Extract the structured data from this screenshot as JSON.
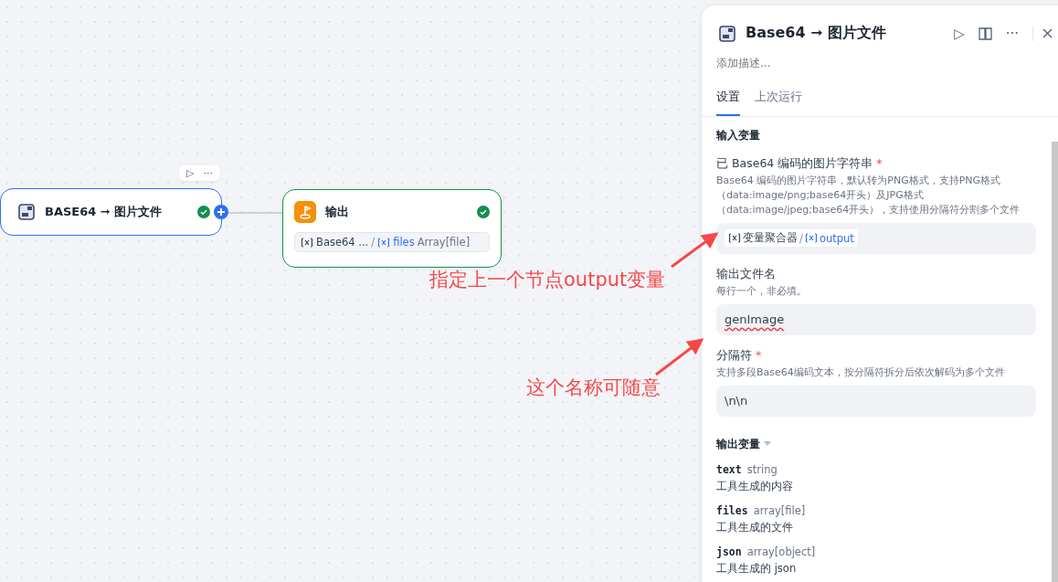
{
  "canvas": {
    "nodes": [
      {
        "kind": "tool",
        "title": "BASE64 ➞ 图片文件",
        "status_ok": true,
        "selected": true,
        "toolbar": {
          "run": "▷",
          "more": "···"
        }
      },
      {
        "kind": "output",
        "title": "输出",
        "status_ok": true,
        "selected": false,
        "var": {
          "source": "Base64 ...",
          "sep": "/",
          "name": "files",
          "type": "Array[file]"
        }
      }
    ],
    "annotations": [
      {
        "text": "指定上一个节点output变量"
      },
      {
        "text": "这个名称可随意"
      }
    ]
  },
  "panel": {
    "title": "Base64 ➞ 图片文件",
    "actions": {
      "run": "▷",
      "more": "···"
    },
    "required_mark": "*",
    "description_placeholder": "添加描述...",
    "tabs": [
      {
        "label": "设置",
        "selected": true
      },
      {
        "label": "上次运行",
        "selected": false
      }
    ],
    "input_section": "输入变量",
    "fields": [
      {
        "kind": "ref",
        "label": "已 Base64 编码的图片字符串",
        "required": true,
        "help": "Base64 编码的图片字符串，默认转为PNG格式，支持PNG格式（data:image/png;base64开头）及JPG格式（data:image/jpeg;base64开头），支持使用分隔符分割多个文件",
        "ref": {
          "source": "变量聚合器",
          "sep": "/",
          "name": "output"
        }
      },
      {
        "kind": "text",
        "label": "输出文件名",
        "required": false,
        "help": "每行一个，非必填。",
        "value": "genImage"
      },
      {
        "kind": "text",
        "label": "分隔符",
        "required": true,
        "help": "支持多段Base64编码文本，按分隔符拆分后依次解码为多个文件",
        "value": "\\n\\n"
      }
    ],
    "output_section": "输出变量",
    "outputs": [
      {
        "name": "text",
        "type": "string",
        "desc": "工具生成的内容"
      },
      {
        "name": "files",
        "type": "array[file]",
        "desc": "工具生成的文件"
      },
      {
        "name": "json",
        "type": "array[object]",
        "desc": "工具生成的 json"
      }
    ]
  }
}
